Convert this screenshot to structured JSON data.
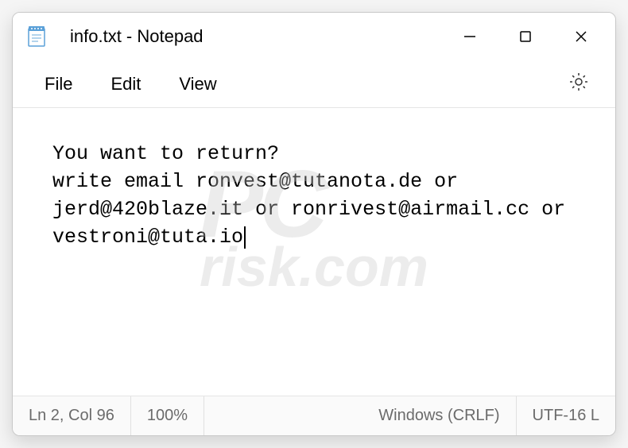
{
  "titlebar": {
    "title": "info.txt - Notepad"
  },
  "menubar": {
    "file": "File",
    "edit": "Edit",
    "view": "View"
  },
  "content": {
    "text": "You want to return?\nwrite email ronvest@tutanota.de or jerd@420blaze.it or ronrivest@airmail.cc or vestroni@tuta.io"
  },
  "statusbar": {
    "position": "Ln 2, Col 96",
    "zoom": "100%",
    "lineending": "Windows (CRLF)",
    "encoding": "UTF-16 L"
  }
}
